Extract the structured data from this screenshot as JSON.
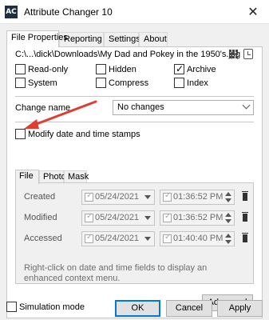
{
  "window": {
    "title": "Attribute Changer 10",
    "app_icon_text": "AC",
    "close_glyph": "✕"
  },
  "tabs": [
    {
      "label": "File Properties",
      "active": true
    },
    {
      "label": "Reporting"
    },
    {
      "label": "Settings"
    },
    {
      "label": "About"
    }
  ],
  "file": {
    "path": "C:\\...\\dick\\Downloads\\My Dad and Pokey in the 1950's.jpg"
  },
  "attributes": [
    {
      "label": "Read-only",
      "checked": false
    },
    {
      "label": "Hidden",
      "checked": false
    },
    {
      "label": "Archive",
      "checked": true
    },
    {
      "label": "System",
      "checked": false
    },
    {
      "label": "Compress",
      "checked": false
    },
    {
      "label": "Index",
      "checked": false
    }
  ],
  "change_name": {
    "label": "Change name",
    "value": "No changes"
  },
  "modify_dates": {
    "label": "Modify date and time stamps",
    "checked": false
  },
  "subtabs": [
    {
      "label": "File",
      "active": true
    },
    {
      "label": "Photo"
    },
    {
      "label": "Mask"
    }
  ],
  "dates": [
    {
      "label": "Created",
      "date": "05/24/2021",
      "time": "01:36:52  PM"
    },
    {
      "label": "Modified",
      "date": "05/24/2021",
      "time": "01:36:52  PM"
    },
    {
      "label": "Accessed",
      "date": "05/24/2021",
      "time": "01:40:40  PM"
    }
  ],
  "hint": "Right-click on date and time fields to display an enhanced context menu.",
  "buttons": {
    "advanced": "Advanced",
    "ok": "OK",
    "cancel": "Cancel",
    "apply": "Apply"
  },
  "simulation_mode": {
    "label": "Simulation mode",
    "checked": false
  },
  "colors": {
    "accent": "#0078d7",
    "arrow": "#e03c31"
  }
}
